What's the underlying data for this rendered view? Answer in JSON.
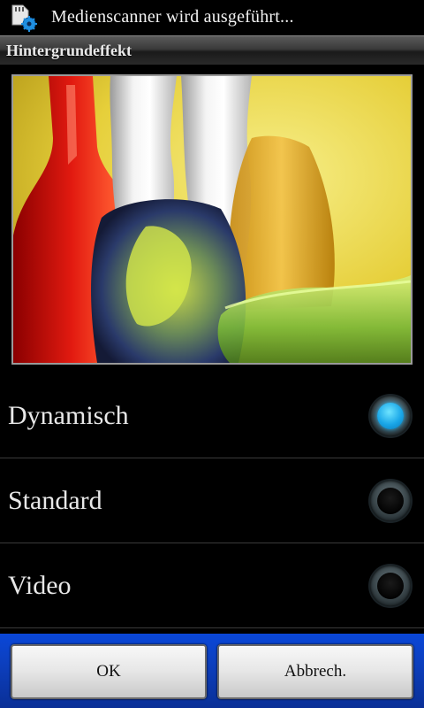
{
  "statusbar": {
    "notification_text": "Medienscanner wird ausgeführt...",
    "icon": "sd-card-gear-icon"
  },
  "dialog": {
    "title": "Hintergrundeffekt",
    "options": [
      {
        "label": "Dynamisch",
        "selected": true
      },
      {
        "label": "Standard",
        "selected": false
      },
      {
        "label": "Video",
        "selected": false
      }
    ],
    "ok_label": "OK",
    "cancel_label": "Abbrech."
  },
  "colors": {
    "accent": "#1aa7e8",
    "button_bar": "#0c3fbe"
  }
}
